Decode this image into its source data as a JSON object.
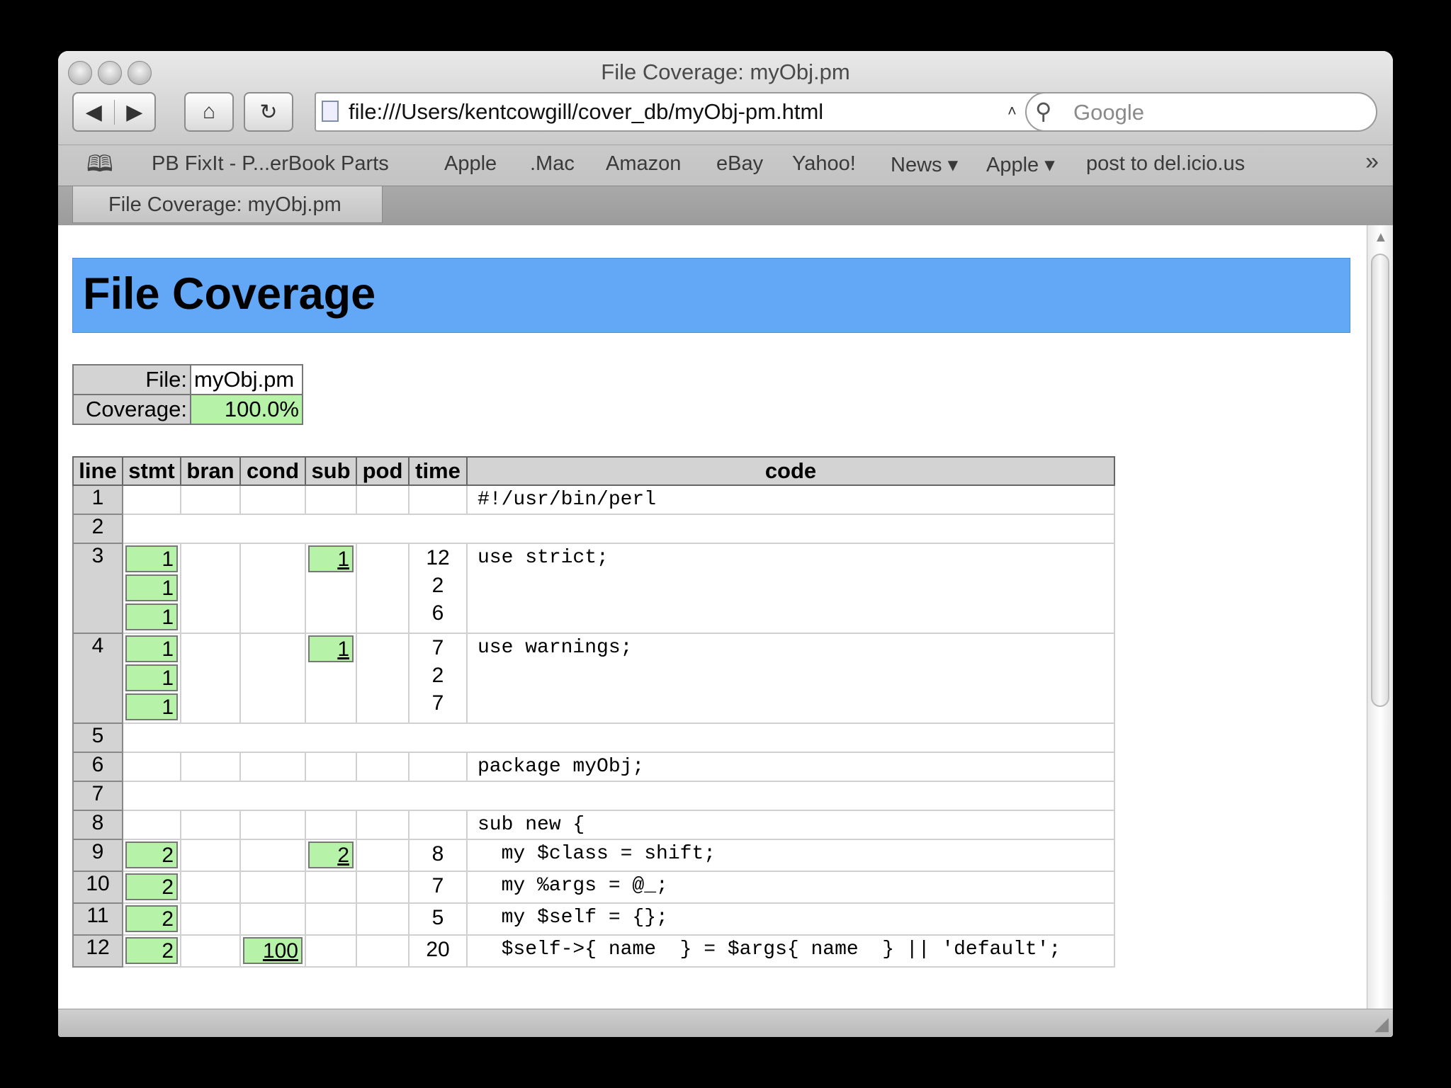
{
  "window": {
    "title": "File Coverage: myObj.pm"
  },
  "toolbar": {
    "back": "◀",
    "forward": "▶",
    "home": "⌂",
    "reload": "↻",
    "url": "file:///Users/kentcowgill/cover_db/myObj-pm.html",
    "search_placeholder": "Google"
  },
  "bookmarks": [
    "PB FixIt - P...erBook Parts",
    "Apple",
    ".Mac",
    "Amazon",
    "eBay",
    "Yahoo!",
    "News ▾",
    "Apple ▾",
    "post to del.icio.us"
  ],
  "tab": {
    "label": "File Coverage: myObj.pm"
  },
  "page": {
    "heading": "File Coverage",
    "file_label": "File:",
    "file_value": "myObj.pm",
    "coverage_label": "Coverage:",
    "coverage_value": "100.0%"
  },
  "columns": [
    "line",
    "stmt",
    "bran",
    "cond",
    "sub",
    "pod",
    "time",
    "code"
  ],
  "rows": [
    {
      "line": "1",
      "stmt": [],
      "cond": [],
      "sub": [],
      "time": [],
      "code": "#!/usr/bin/perl"
    },
    {
      "line": "2",
      "blank": true
    },
    {
      "line": "3",
      "stmt": [
        "1",
        "1",
        "1"
      ],
      "cond": [],
      "sub": [
        "1"
      ],
      "time": [
        "12",
        "2",
        "6"
      ],
      "code": "use strict;"
    },
    {
      "line": "4",
      "stmt": [
        "1",
        "1",
        "1"
      ],
      "cond": [],
      "sub": [
        "1"
      ],
      "time": [
        "7",
        "2",
        "7"
      ],
      "code": "use warnings;"
    },
    {
      "line": "5",
      "blank": true
    },
    {
      "line": "6",
      "stmt": [],
      "cond": [],
      "sub": [],
      "time": [],
      "code": "package myObj;"
    },
    {
      "line": "7",
      "blank": true
    },
    {
      "line": "8",
      "stmt": [],
      "cond": [],
      "sub": [],
      "time": [],
      "code": "sub new {"
    },
    {
      "line": "9",
      "stmt": [
        "2"
      ],
      "cond": [],
      "sub": [
        "2"
      ],
      "time": [
        "8"
      ],
      "code": "  my $class = shift;"
    },
    {
      "line": "10",
      "stmt": [
        "2"
      ],
      "cond": [],
      "sub": [],
      "time": [
        "7"
      ],
      "code": "  my %args = @_;"
    },
    {
      "line": "11",
      "stmt": [
        "2"
      ],
      "cond": [],
      "sub": [],
      "time": [
        "5"
      ],
      "code": "  my $self = {};"
    },
    {
      "line": "12",
      "stmt": [
        "2"
      ],
      "cond": [
        "100"
      ],
      "sub": [],
      "time": [
        "20"
      ],
      "code": "  $self->{ name  } = $args{ name  } || 'default';"
    }
  ]
}
